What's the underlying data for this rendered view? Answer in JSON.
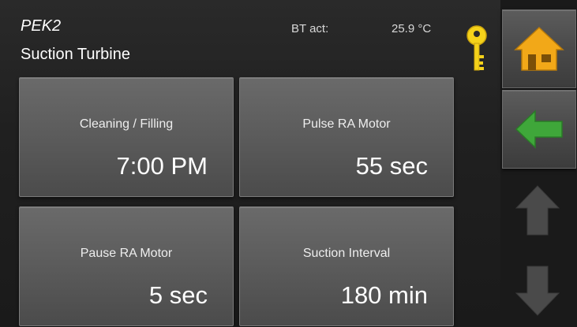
{
  "header": {
    "device": "PEK2",
    "title": "Suction Turbine",
    "bt_label": "BT act:",
    "bt_value": "25.9 °C"
  },
  "tiles": [
    {
      "label": "Cleaning / Filling",
      "value": "7:00 PM"
    },
    {
      "label": "Pulse RA Motor",
      "value": "55 sec"
    },
    {
      "label": "Pause RA Motor",
      "value": "5 sec"
    },
    {
      "label": "Suction Interval",
      "value": "180 min"
    }
  ],
  "sidebar": {
    "home_icon": "home-icon",
    "back_icon": "arrow-left-icon",
    "up_icon": "arrow-up-icon",
    "down_icon": "arrow-down-icon"
  },
  "colors": {
    "home_accent": "#f2a818",
    "back_accent": "#3fa73a",
    "key_accent": "#f5d21a",
    "scroll_disabled": "#4a4a4a"
  }
}
